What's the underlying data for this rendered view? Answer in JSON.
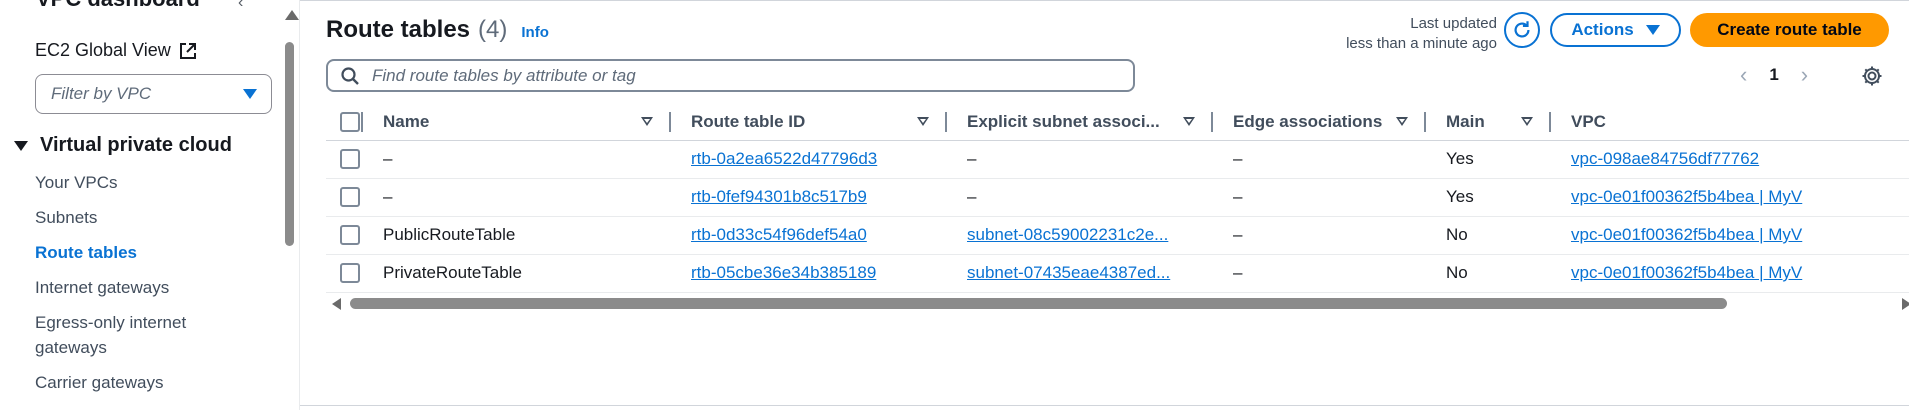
{
  "sidebar": {
    "top_title": "VPC dashboard",
    "ec2_global_view": "EC2 Global View",
    "filter_placeholder": "Filter by VPC",
    "section_label": "Virtual private cloud",
    "items": [
      {
        "label": "Your VPCs",
        "active": false
      },
      {
        "label": "Subnets",
        "active": false
      },
      {
        "label": "Route tables",
        "active": true
      },
      {
        "label": "Internet gateways",
        "active": false
      },
      {
        "label": "Egress-only internet gateways",
        "active": false
      },
      {
        "label": "Carrier gateways",
        "active": false
      }
    ]
  },
  "header": {
    "title": "Route tables",
    "count": "(4)",
    "info": "Info",
    "last_updated_label": "Last updated",
    "last_updated_value": "less than a minute ago",
    "actions_label": "Actions",
    "create_label": "Create route table"
  },
  "search": {
    "placeholder": "Find route tables by attribute or tag"
  },
  "pagination": {
    "current_page": "1"
  },
  "table": {
    "columns": [
      "Name",
      "Route table ID",
      "Explicit subnet associ...",
      "Edge associations",
      "Main",
      "VPC"
    ],
    "rows": [
      {
        "name": "–",
        "route_table_id": "rtb-0a2ea6522d47796d3",
        "explicit_subnet": "–",
        "explicit_is_link": false,
        "edge": "–",
        "main": "Yes",
        "vpc": "vpc-098ae84756df77762"
      },
      {
        "name": "–",
        "route_table_id": "rtb-0fef94301b8c517b9",
        "explicit_subnet": "–",
        "explicit_is_link": false,
        "edge": "–",
        "main": "Yes",
        "vpc": "vpc-0e01f00362f5b4bea | MyV"
      },
      {
        "name": "PublicRouteTable",
        "route_table_id": "rtb-0d33c54f96def54a0",
        "explicit_subnet": "subnet-08c59002231c2e...",
        "explicit_is_link": true,
        "edge": "–",
        "main": "No",
        "vpc": "vpc-0e01f00362f5b4bea | MyV"
      },
      {
        "name": "PrivateRouteTable",
        "route_table_id": "rtb-05cbe36e34b385189",
        "explicit_subnet": "subnet-07435eae4387ed...",
        "explicit_is_link": true,
        "edge": "–",
        "main": "No",
        "vpc": "vpc-0e01f00362f5b4bea | MyV"
      }
    ]
  },
  "colors": {
    "link": "#0972d3",
    "primary_button": "#ff9900",
    "text": "#16191f",
    "muted": "#5f6b7a"
  },
  "icons": {
    "external": "external-link-icon",
    "refresh": "refresh-icon",
    "search": "search-icon",
    "settings": "gear-icon"
  }
}
